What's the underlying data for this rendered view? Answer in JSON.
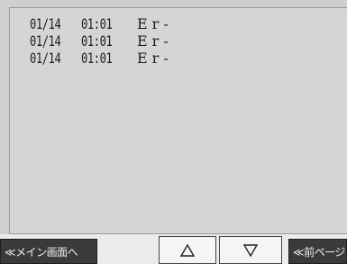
{
  "log": {
    "entries": [
      {
        "date": "01/14",
        "time": "01:01",
        "code": "Er-"
      },
      {
        "date": "01/14",
        "time": "01:01",
        "code": "Er-"
      },
      {
        "date": "01/14",
        "time": "01:01",
        "code": "Er-"
      }
    ]
  },
  "footer": {
    "main_menu_label": "≪メイン画面へ",
    "scroll_up_icon": "up-triangle-icon",
    "scroll_down_icon": "down-triangle-icon",
    "prev_page_label": "≪前ページ"
  },
  "colors": {
    "screen_bg": "#cfcfcf",
    "panel_bg": "#d5d5d5",
    "dark_button_bg": "#3a3a3a",
    "light_button_bg": "#f5f5f5",
    "text": "#1e1e1e"
  }
}
